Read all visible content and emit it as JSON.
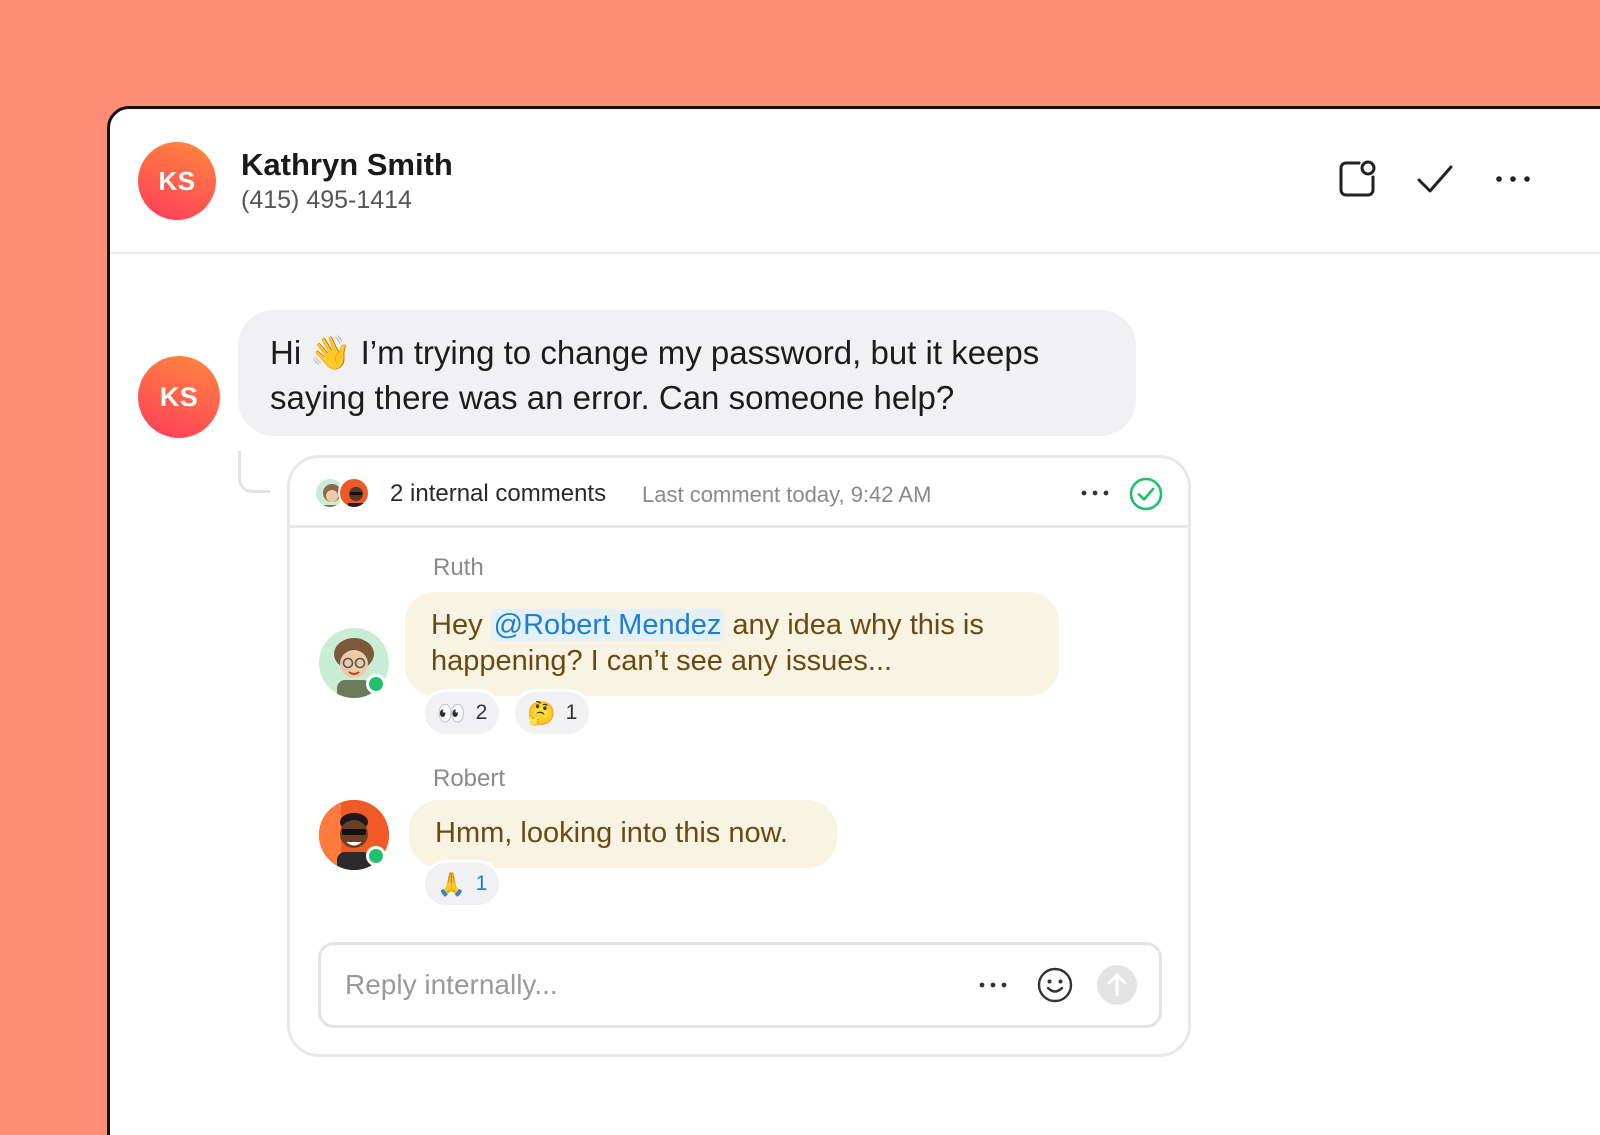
{
  "contact": {
    "initials": "KS",
    "name": "Kathryn Smith",
    "phone": "(415) 495-1414"
  },
  "header_actions": [
    "snooze-icon",
    "check-icon",
    "more-icon"
  ],
  "message": {
    "initials": "KS",
    "text_before": "Hi ",
    "emoji": "👋",
    "text_after": " I’m trying to change my password, but it keeps saying there was an error. Can someone help?"
  },
  "thread": {
    "title": "2 internal comments",
    "subtitle": "Last comment today, 9:42 AM",
    "comments": [
      {
        "author": "Ruth",
        "text_before": "Hey ",
        "mention": "@Robert Mendez",
        "text_after": " any idea why this is happening? I can’t see any issues...",
        "reactions": [
          {
            "emoji": "👀",
            "count": "2"
          },
          {
            "emoji": "🤔",
            "count": "1"
          }
        ]
      },
      {
        "author": "Robert",
        "text": "Hmm, looking into this now.",
        "reactions": [
          {
            "emoji": "🙏",
            "count": "1"
          }
        ]
      }
    ],
    "reply_placeholder": "Reply internally..."
  },
  "colors": {
    "background": "#FF8C75",
    "avatar_gradient_start": "#ff8a3d",
    "avatar_gradient_end": "#ff3b5c",
    "internal_bubble": "#f8f3e3",
    "internal_text": "#6b4a12",
    "mention": "#1a7fd6",
    "resolve_green": "#1fc16b",
    "online": "#1fc16b"
  }
}
